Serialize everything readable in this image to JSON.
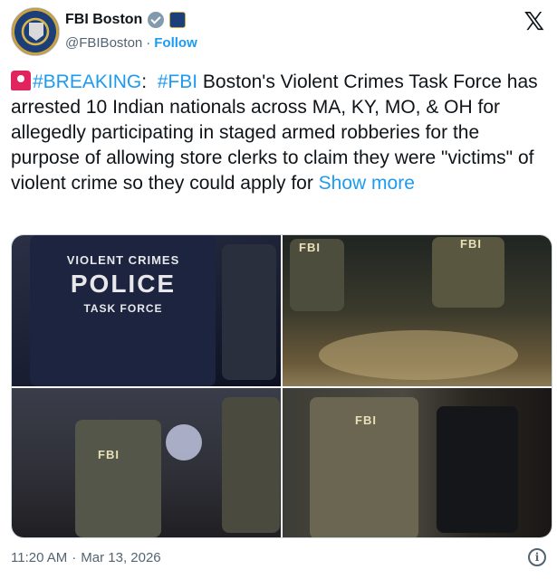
{
  "author": {
    "name": "FBI Boston",
    "handle": "@FBIBoston",
    "follow_label": "Follow",
    "separator": "·"
  },
  "tweet": {
    "hashtag_breaking": "#BREAKING",
    "colon": ":",
    "hashtag_fbi": "#FBI",
    "body": " Boston's Violent Crimes Task Force has arrested 10 Indian nationals across MA, KY, MO, & OH for allegedly participating in staged armed robberies for the purpose of allowing store clerks to claim they were \"victims\" of violent crime so they could apply for ",
    "show_more": "Show more"
  },
  "photos": {
    "shirt_line1": "VIOLENT CRIMES",
    "shirt_line2": "POLICE",
    "shirt_line3": "TASK FORCE",
    "vest_label": "FBI"
  },
  "footer": {
    "time": "11:20 AM",
    "separator": "·",
    "date": "Mar 13, 2026",
    "info_glyph": "i"
  },
  "icons": {
    "logo": "x-logo-icon",
    "verified": "verified-badge-icon",
    "affiliation": "affiliation-badge-icon",
    "siren": "siren-emoji-icon",
    "info": "info-icon"
  },
  "colors": {
    "link": "#1d9bf0",
    "secondary_text": "#536471",
    "verified_gray": "#829aab"
  }
}
